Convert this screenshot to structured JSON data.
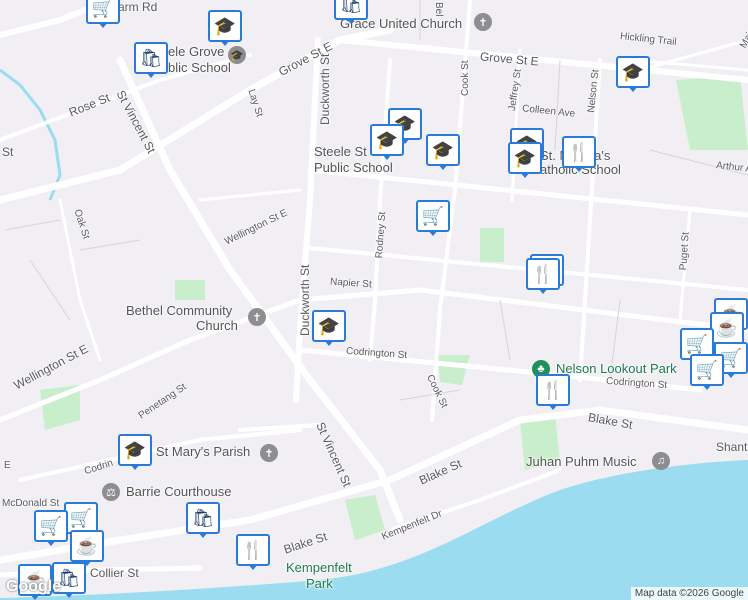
{
  "labels": {
    "streets": [
      {
        "id": "grove-st-e-west",
        "text": "Grove St E"
      },
      {
        "id": "grove-st-e-east",
        "text": "Grove St E"
      },
      {
        "id": "duckworth-st-top",
        "text": "Duckworth St"
      },
      {
        "id": "duckworth-st-mid",
        "text": "Duckworth St"
      },
      {
        "id": "st-vincent-st-top",
        "text": "St Vincent St"
      },
      {
        "id": "st-vincent-st-bottom",
        "text": "St Vincent St"
      },
      {
        "id": "rose-st",
        "text": "Rose St"
      },
      {
        "id": "lay-st",
        "text": "Lay St"
      },
      {
        "id": "oak-st",
        "text": "Oak St"
      },
      {
        "id": "wellington-st-e-top",
        "text": "Wellington St E"
      },
      {
        "id": "wellington-st-e-left",
        "text": "Wellington St E"
      },
      {
        "id": "cook-st-top",
        "text": "Cook St"
      },
      {
        "id": "cook-st-bottom",
        "text": "Cook St"
      },
      {
        "id": "jeffrey-st",
        "text": "Jeffrey St"
      },
      {
        "id": "nelson-st",
        "text": "Nelson St"
      },
      {
        "id": "colleen-ave",
        "text": "Colleen Ave"
      },
      {
        "id": "hickling-trail",
        "text": "Hickling Trail"
      },
      {
        "id": "maitland-dr",
        "text": "Maitland Dr"
      },
      {
        "id": "arthur-ave",
        "text": "Arthur A"
      },
      {
        "id": "rodney-st",
        "text": "Rodney St"
      },
      {
        "id": "napier-st",
        "text": "Napier St"
      },
      {
        "id": "puget-st",
        "text": "Puget St"
      },
      {
        "id": "codrington-st-mid",
        "text": "Codrington St"
      },
      {
        "id": "codrington-st-east",
        "text": "Codrington St"
      },
      {
        "id": "codrington-st-west",
        "text": "Codrin"
      },
      {
        "id": "penetang-st",
        "text": "Penetang St"
      },
      {
        "id": "blake-st-east",
        "text": "Blake St"
      },
      {
        "id": "blake-st-mid",
        "text": "Blake St"
      },
      {
        "id": "blake-st-west",
        "text": "Blake St"
      },
      {
        "id": "kempenfelt-dr",
        "text": "Kempenfelt Dr"
      },
      {
        "id": "mcdonald-st",
        "text": "McDonald St"
      },
      {
        "id": "collier-st",
        "text": "Collier St"
      },
      {
        "id": "farm-rd",
        "text": "arm Rd"
      },
      {
        "id": "st-left",
        "text": "St"
      },
      {
        "id": "e-left",
        "text": "E"
      },
      {
        "id": "shanty",
        "text": "Shant"
      },
      {
        "id": "bel",
        "text": "Bel"
      }
    ],
    "places": [
      {
        "id": "grace-united-church",
        "text": "Grace United Church"
      },
      {
        "id": "steele-grove-school-a",
        "text": "ele Grove"
      },
      {
        "id": "steele-grove-school-b",
        "text": "blic School"
      },
      {
        "id": "steele-st-school-a",
        "text": "Steele St"
      },
      {
        "id": "steele-st-school-b",
        "text": "Public School"
      },
      {
        "id": "st-monicas-a",
        "text": "St. Monica's"
      },
      {
        "id": "st-monicas-b",
        "text": "atholic School"
      },
      {
        "id": "bethel-church-a",
        "text": "Bethel Community"
      },
      {
        "id": "bethel-church-b",
        "text": "Church"
      },
      {
        "id": "nelson-lookout-park",
        "text": "Nelson Lookout Park"
      },
      {
        "id": "st-marys-parish",
        "text": "St Mary's Parish"
      },
      {
        "id": "barrie-courthouse",
        "text": "Barrie Courthouse"
      },
      {
        "id": "juhan-puhm-music",
        "text": "Juhan Puhm Music"
      },
      {
        "id": "kempenfelt-park-a",
        "text": "Kempenfelt"
      },
      {
        "id": "kempenfelt-park-b",
        "text": "Park"
      }
    ]
  },
  "markers": [
    {
      "id": "school",
      "icon": "🎓"
    },
    {
      "id": "shopping",
      "icon": "🛍"
    },
    {
      "id": "grocery",
      "icon": "🛒"
    },
    {
      "id": "restaurant",
      "icon": "🍴"
    },
    {
      "id": "cafe",
      "icon": "☕"
    }
  ],
  "branding": {
    "logo": "Google",
    "attribution": "Map data ©2026 Google"
  },
  "colors": {
    "water": "#9bdcf0",
    "park": "#c9eecb",
    "road": "#ffffff",
    "marker_border": "#2a7bd8",
    "marker_icon": "#1a3d6a"
  }
}
